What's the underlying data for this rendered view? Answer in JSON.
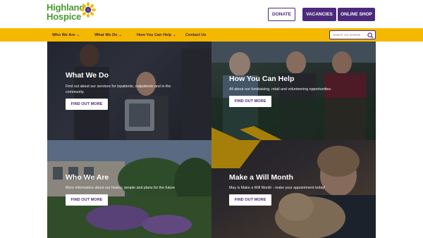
{
  "header": {
    "logo": {
      "line1": "Highland",
      "line2": "Hospice"
    },
    "buttons": {
      "donate": "DONATE",
      "vacancies": "VACANCIES",
      "shop": "ONLINE SHOP"
    }
  },
  "nav": {
    "items": [
      {
        "label": "Who We Are",
        "chevron": "⌄"
      },
      {
        "label": "What We Do",
        "chevron": "⌄"
      },
      {
        "label": "How You Can Help",
        "chevron": "⌄"
      },
      {
        "label": "Contact Us"
      }
    ],
    "search_placeholder": "Search our website",
    "search_icon": "search-icon"
  },
  "tiles": [
    {
      "title": "What We Do",
      "description": "Find out about our services for inpatients, outpatients and in the community.",
      "button": "FIND OUT MORE"
    },
    {
      "title": "How You Can Help",
      "description": "All about our fundraising, retail and volunteering opportunities.",
      "button": "FIND OUT MORE"
    },
    {
      "title": "Who We Are",
      "description": "More information about our history, people and plans for the future",
      "button": "FIND OUT MORE"
    },
    {
      "title": "Make a Will Month",
      "description": "May is Make a Will Month - make your appointment today!",
      "button": "FIND OUT MORE"
    }
  ],
  "colors": {
    "brand_purple": "#4b2a7b",
    "nav_yellow": "#f5b800",
    "logo_green": "#4a9a2e"
  }
}
